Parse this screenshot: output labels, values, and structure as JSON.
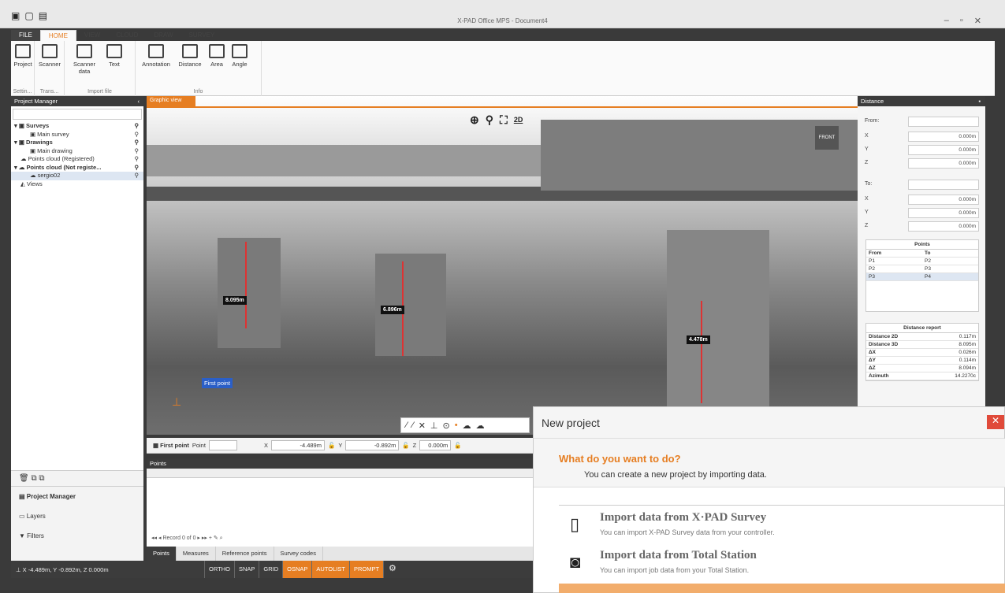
{
  "window": {
    "title": "X-PAD Office MPS - Document4"
  },
  "ribbon": {
    "tabs": [
      "FILE",
      "HOME",
      "VIEW",
      "CLOUD",
      "DRAW",
      "SURVEY"
    ],
    "buttons": {
      "project": "Project",
      "scanner": "Scanner",
      "scanner_data": "Scanner data",
      "text": "Text",
      "annotation": "Annotation",
      "distance": "Distance",
      "area": "Area",
      "angle": "Angle"
    },
    "groups": {
      "settings": "Settin...",
      "trans": "Trans...",
      "import": "Import file",
      "info": "Info"
    }
  },
  "project_manager": {
    "title": "Project Manager",
    "tree": [
      "Surveys",
      "Main survey",
      "Drawings",
      "Main drawing",
      "Points cloud (Registered)",
      "Points cloud (Not registe...",
      "sergio02",
      "Views"
    ],
    "nav": {
      "project_manager": "Project Manager",
      "layers": "Layers",
      "filters": "Filters"
    }
  },
  "viewport": {
    "tab": "Graphic view",
    "mode": "2D",
    "front": "FRONT",
    "measurements": [
      "8.095m",
      "6.896m",
      "4.478m"
    ],
    "first_point_label": "First point"
  },
  "coord_bar": {
    "first_point": "First point",
    "point_label": "Point",
    "x_label": "X",
    "x_value": "-4.489m",
    "y_label": "Y",
    "y_value": "-0.892m",
    "z_label": "Z",
    "z_value": "0.000m"
  },
  "points_panel": {
    "title": "Points",
    "record": "Record 0 of 0",
    "tabs": [
      "Points",
      "Measures",
      "Reference points",
      "Survey codes"
    ]
  },
  "statusbar": {
    "coords": "X -4.489m, Y -0.892m, Z 0.000m",
    "buttons": [
      "ORTHO",
      "SNAP",
      "GRID",
      "OSNAP",
      "AUTOLIST",
      "PROMPT"
    ],
    "on": [
      "OSNAP",
      "AUTOLIST",
      "PROMPT"
    ]
  },
  "distance_panel": {
    "title": "Distance",
    "from_label": "From:",
    "to_label": "To:",
    "from": {
      "x": "0.000m",
      "y": "0.000m",
      "z": "0.000m"
    },
    "to": {
      "x": "0.000m",
      "y": "0.000m",
      "z": "0.000m"
    },
    "axis": [
      "X",
      "Y",
      "Z"
    ],
    "points_title": "Points",
    "points_cols": [
      "From",
      "To"
    ],
    "points_rows": [
      [
        "P1",
        "P2"
      ],
      [
        "P2",
        "P3"
      ],
      [
        "P3",
        "P4"
      ]
    ],
    "report_title": "Distance report",
    "report": [
      [
        "Distance 2D",
        "0.117m"
      ],
      [
        "Distance 3D",
        "8.095m"
      ],
      [
        "ΔX",
        "0.026m"
      ],
      [
        "ΔY",
        "0.114m"
      ],
      [
        "ΔZ",
        "8.094m"
      ],
      [
        "Azimuth",
        "14.2270c"
      ]
    ]
  },
  "dialog": {
    "title": "New project",
    "heading": "What do you want to do?",
    "subheading": "You can create a new project by importing data.",
    "options": [
      {
        "title": "Import data from X·PAD Survey",
        "desc": "You can import X-PAD Survey data from your controller."
      },
      {
        "title": "Import data from Total Station",
        "desc": "You can import job data from your Total Station."
      }
    ]
  }
}
